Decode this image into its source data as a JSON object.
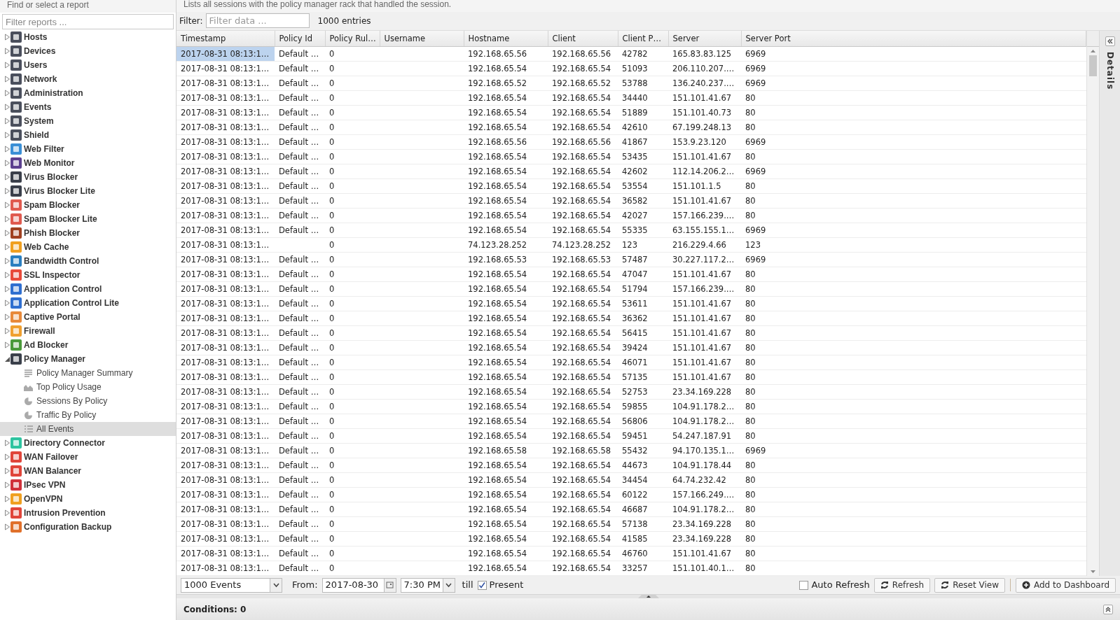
{
  "sidebar": {
    "heading": "Find or select a report",
    "filter": {
      "placeholder": "Filter reports ..."
    },
    "tree": [
      {
        "label": "Hosts",
        "color": "#4a4f5c",
        "expanded": false,
        "selected": false
      },
      {
        "label": "Devices",
        "color": "#4a4f5c",
        "expanded": false,
        "selected": false
      },
      {
        "label": "Users",
        "color": "#4a4f5c",
        "expanded": false,
        "selected": false
      },
      {
        "label": "Network",
        "color": "#4a4f5c",
        "expanded": false,
        "selected": false
      },
      {
        "label": "Administration",
        "color": "#4a4f5c",
        "expanded": false,
        "selected": false
      },
      {
        "label": "Events",
        "color": "#4a4f5c",
        "expanded": false,
        "selected": false
      },
      {
        "label": "System",
        "color": "#4a4f5c",
        "expanded": false,
        "selected": false
      },
      {
        "label": "Shield",
        "color": "#4a4f5c",
        "expanded": false,
        "selected": false
      },
      {
        "label": "Web Filter",
        "color": "#3a8fd6",
        "expanded": false,
        "selected": false
      },
      {
        "label": "Web Monitor",
        "color": "#5b3f8f",
        "expanded": false,
        "selected": false
      },
      {
        "label": "Virus Blocker",
        "color": "#3a3f4a",
        "expanded": false,
        "selected": false
      },
      {
        "label": "Virus Blocker Lite",
        "color": "#3a3f4a",
        "expanded": false,
        "selected": false
      },
      {
        "label": "Spam Blocker",
        "color": "#e05a4f",
        "expanded": false,
        "selected": false
      },
      {
        "label": "Spam Blocker Lite",
        "color": "#e05a4f",
        "expanded": false,
        "selected": false
      },
      {
        "label": "Phish Blocker",
        "color": "#a04020",
        "expanded": false,
        "selected": false
      },
      {
        "label": "Web Cache",
        "color": "#f0a020",
        "expanded": false,
        "selected": false
      },
      {
        "label": "Bandwidth Control",
        "color": "#2a7fc0",
        "expanded": false,
        "selected": false
      },
      {
        "label": "SSL Inspector",
        "color": "#e84a3a",
        "expanded": false,
        "selected": false
      },
      {
        "label": "Application Control",
        "color": "#2f6fd0",
        "expanded": false,
        "selected": false
      },
      {
        "label": "Application Control Lite",
        "color": "#2f6fd0",
        "expanded": false,
        "selected": false
      },
      {
        "label": "Captive Portal",
        "color": "#e88a3a",
        "expanded": false,
        "selected": false
      },
      {
        "label": "Firewall",
        "color": "#f0a030",
        "expanded": false,
        "selected": false
      },
      {
        "label": "Ad Blocker",
        "color": "#4a9a3a",
        "expanded": false,
        "selected": false
      },
      {
        "label": "Policy Manager",
        "color": "#3a3f4a",
        "expanded": true,
        "selected": false,
        "children": [
          {
            "label": "Policy Manager Summary",
            "kind": "text",
            "selected": false
          },
          {
            "label": "Top Policy Usage",
            "kind": "area",
            "selected": false
          },
          {
            "label": "Sessions By Policy",
            "kind": "pie",
            "selected": false
          },
          {
            "label": "Traffic By Policy",
            "kind": "pie",
            "selected": false
          },
          {
            "label": "All Events",
            "kind": "list",
            "selected": true
          }
        ]
      },
      {
        "label": "Directory Connector",
        "color": "#2ec4a0",
        "expanded": false,
        "selected": false
      },
      {
        "label": "WAN Failover",
        "color": "#e0453a",
        "expanded": false,
        "selected": false
      },
      {
        "label": "WAN Balancer",
        "color": "#e0453a",
        "expanded": false,
        "selected": false
      },
      {
        "label": "IPsec VPN",
        "color": "#d0303a",
        "expanded": false,
        "selected": false
      },
      {
        "label": "OpenVPN",
        "color": "#f0a020",
        "expanded": false,
        "selected": false
      },
      {
        "label": "Intrusion Prevention",
        "color": "#e0453a",
        "expanded": false,
        "selected": false
      },
      {
        "label": "Configuration Backup",
        "color": "#e0702a",
        "expanded": false,
        "selected": false
      }
    ]
  },
  "description": "Lists all sessions with the policy manager rack that handled the session.",
  "filter_bar": {
    "label": "Filter:",
    "placeholder": "Filter data ...",
    "count": "1000 entries"
  },
  "table": {
    "columns": [
      "Timestamp",
      "Policy Id",
      "Policy Rul…",
      "Username",
      "Hostname",
      "Client",
      "Client P…",
      "Server",
      "Server Port"
    ],
    "rows": [
      {
        "selected": true,
        "cells": [
          "2017-08-31 08:13:1…",
          "Default …",
          "0",
          "",
          "192.168.65.56",
          "192.168.65.56",
          "42782",
          "165.83.83.125",
          "6969"
        ]
      },
      {
        "selected": false,
        "cells": [
          "2017-08-31 08:13:1…",
          "Default …",
          "0",
          "",
          "192.168.65.54",
          "192.168.65.54",
          "51093",
          "206.110.207.…",
          "6969"
        ]
      },
      {
        "selected": false,
        "cells": [
          "2017-08-31 08:13:1…",
          "Default …",
          "0",
          "",
          "192.168.65.52",
          "192.168.65.52",
          "53788",
          "136.240.237.…",
          "6969"
        ]
      },
      {
        "selected": false,
        "cells": [
          "2017-08-31 08:13:1…",
          "Default …",
          "0",
          "",
          "192.168.65.54",
          "192.168.65.54",
          "34440",
          "151.101.41.67",
          "80"
        ]
      },
      {
        "selected": false,
        "cells": [
          "2017-08-31 08:13:1…",
          "Default …",
          "0",
          "",
          "192.168.65.54",
          "192.168.65.54",
          "51889",
          "151.101.40.73",
          "80"
        ]
      },
      {
        "selected": false,
        "cells": [
          "2017-08-31 08:13:1…",
          "Default …",
          "0",
          "",
          "192.168.65.54",
          "192.168.65.54",
          "42610",
          "67.199.248.13",
          "80"
        ]
      },
      {
        "selected": false,
        "cells": [
          "2017-08-31 08:13:1…",
          "Default …",
          "0",
          "",
          "192.168.65.56",
          "192.168.65.56",
          "41867",
          "153.9.23.120",
          "6969"
        ]
      },
      {
        "selected": false,
        "cells": [
          "2017-08-31 08:13:1…",
          "Default …",
          "0",
          "",
          "192.168.65.54",
          "192.168.65.54",
          "53435",
          "151.101.41.67",
          "80"
        ]
      },
      {
        "selected": false,
        "cells": [
          "2017-08-31 08:13:1…",
          "Default …",
          "0",
          "",
          "192.168.65.54",
          "192.168.65.54",
          "42602",
          "112.14.206.2…",
          "6969"
        ]
      },
      {
        "selected": false,
        "cells": [
          "2017-08-31 08:13:1…",
          "Default …",
          "0",
          "",
          "192.168.65.54",
          "192.168.65.54",
          "53554",
          "151.101.1.5",
          "80"
        ]
      },
      {
        "selected": false,
        "cells": [
          "2017-08-31 08:13:1…",
          "Default …",
          "0",
          "",
          "192.168.65.54",
          "192.168.65.54",
          "36582",
          "151.101.41.67",
          "80"
        ]
      },
      {
        "selected": false,
        "cells": [
          "2017-08-31 08:13:1…",
          "Default …",
          "0",
          "",
          "192.168.65.54",
          "192.168.65.54",
          "42027",
          "157.166.239.…",
          "80"
        ]
      },
      {
        "selected": false,
        "cells": [
          "2017-08-31 08:13:1…",
          "Default …",
          "0",
          "",
          "192.168.65.54",
          "192.168.65.54",
          "55335",
          "63.155.155.1…",
          "6969"
        ]
      },
      {
        "selected": false,
        "cells": [
          "2017-08-31 08:13:1…",
          "",
          "0",
          "",
          "74.123.28.252",
          "74.123.28.252",
          "123",
          "216.229.4.66",
          "123"
        ]
      },
      {
        "selected": false,
        "cells": [
          "2017-08-31 08:13:1…",
          "Default …",
          "0",
          "",
          "192.168.65.53",
          "192.168.65.53",
          "57487",
          "30.227.117.2…",
          "6969"
        ]
      },
      {
        "selected": false,
        "cells": [
          "2017-08-31 08:13:1…",
          "Default …",
          "0",
          "",
          "192.168.65.54",
          "192.168.65.54",
          "47047",
          "151.101.41.67",
          "80"
        ]
      },
      {
        "selected": false,
        "cells": [
          "2017-08-31 08:13:1…",
          "Default …",
          "0",
          "",
          "192.168.65.54",
          "192.168.65.54",
          "51794",
          "157.166.239.…",
          "80"
        ]
      },
      {
        "selected": false,
        "cells": [
          "2017-08-31 08:13:1…",
          "Default …",
          "0",
          "",
          "192.168.65.54",
          "192.168.65.54",
          "53611",
          "151.101.41.67",
          "80"
        ]
      },
      {
        "selected": false,
        "cells": [
          "2017-08-31 08:13:1…",
          "Default …",
          "0",
          "",
          "192.168.65.54",
          "192.168.65.54",
          "36362",
          "151.101.41.67",
          "80"
        ]
      },
      {
        "selected": false,
        "cells": [
          "2017-08-31 08:13:1…",
          "Default …",
          "0",
          "",
          "192.168.65.54",
          "192.168.65.54",
          "56415",
          "151.101.41.67",
          "80"
        ]
      },
      {
        "selected": false,
        "cells": [
          "2017-08-31 08:13:1…",
          "Default …",
          "0",
          "",
          "192.168.65.54",
          "192.168.65.54",
          "39424",
          "151.101.41.67",
          "80"
        ]
      },
      {
        "selected": false,
        "cells": [
          "2017-08-31 08:13:1…",
          "Default …",
          "0",
          "",
          "192.168.65.54",
          "192.168.65.54",
          "46071",
          "151.101.41.67",
          "80"
        ]
      },
      {
        "selected": false,
        "cells": [
          "2017-08-31 08:13:1…",
          "Default …",
          "0",
          "",
          "192.168.65.54",
          "192.168.65.54",
          "57135",
          "151.101.41.67",
          "80"
        ]
      },
      {
        "selected": false,
        "cells": [
          "2017-08-31 08:13:1…",
          "Default …",
          "0",
          "",
          "192.168.65.54",
          "192.168.65.54",
          "52753",
          "23.34.169.228",
          "80"
        ]
      },
      {
        "selected": false,
        "cells": [
          "2017-08-31 08:13:1…",
          "Default …",
          "0",
          "",
          "192.168.65.54",
          "192.168.65.54",
          "59855",
          "104.91.178.2…",
          "80"
        ]
      },
      {
        "selected": false,
        "cells": [
          "2017-08-31 08:13:1…",
          "Default …",
          "0",
          "",
          "192.168.65.54",
          "192.168.65.54",
          "56806",
          "104.91.178.2…",
          "80"
        ]
      },
      {
        "selected": false,
        "cells": [
          "2017-08-31 08:13:1…",
          "Default …",
          "0",
          "",
          "192.168.65.54",
          "192.168.65.54",
          "59451",
          "54.247.187.91",
          "80"
        ]
      },
      {
        "selected": false,
        "cells": [
          "2017-08-31 08:13:1…",
          "Default …",
          "0",
          "",
          "192.168.65.58",
          "192.168.65.58",
          "55432",
          "94.170.135.1…",
          "6969"
        ]
      },
      {
        "selected": false,
        "cells": [
          "2017-08-31 08:13:1…",
          "Default …",
          "0",
          "",
          "192.168.65.54",
          "192.168.65.54",
          "44673",
          "104.91.178.44",
          "80"
        ]
      },
      {
        "selected": false,
        "cells": [
          "2017-08-31 08:13:1…",
          "Default …",
          "0",
          "",
          "192.168.65.54",
          "192.168.65.54",
          "34454",
          "64.74.232.42",
          "80"
        ]
      },
      {
        "selected": false,
        "cells": [
          "2017-08-31 08:13:1…",
          "Default …",
          "0",
          "",
          "192.168.65.54",
          "192.168.65.54",
          "60122",
          "157.166.249.…",
          "80"
        ]
      },
      {
        "selected": false,
        "cells": [
          "2017-08-31 08:13:1…",
          "Default …",
          "0",
          "",
          "192.168.65.54",
          "192.168.65.54",
          "46687",
          "104.91.178.2…",
          "80"
        ]
      },
      {
        "selected": false,
        "cells": [
          "2017-08-31 08:13:1…",
          "Default …",
          "0",
          "",
          "192.168.65.54",
          "192.168.65.54",
          "57138",
          "23.34.169.228",
          "80"
        ]
      },
      {
        "selected": false,
        "cells": [
          "2017-08-31 08:13:1…",
          "Default …",
          "0",
          "",
          "192.168.65.54",
          "192.168.65.54",
          "41585",
          "23.34.169.228",
          "80"
        ]
      },
      {
        "selected": false,
        "cells": [
          "2017-08-31 08:13:1…",
          "Default …",
          "0",
          "",
          "192.168.65.54",
          "192.168.65.54",
          "46760",
          "151.101.41.67",
          "80"
        ]
      },
      {
        "selected": false,
        "cells": [
          "2017-08-31 08:13:1…",
          "Default …",
          "0",
          "",
          "192.168.65.54",
          "192.168.65.54",
          "33257",
          "151.101.40.1…",
          "80"
        ]
      }
    ]
  },
  "details_panel": {
    "title": "Details"
  },
  "toolbar": {
    "limit": "1000 Events",
    "from_label": "From:",
    "date": "2017-08-30",
    "time": "7:30 PM",
    "till_label": "till",
    "present": {
      "label": "Present",
      "checked": true
    },
    "auto_refresh": {
      "label": "Auto Refresh",
      "checked": false
    },
    "buttons": [
      {
        "label": "Refresh",
        "kind": "refresh"
      },
      {
        "label": "Reset View",
        "kind": "refresh"
      },
      {
        "label": "Add to Dashboard",
        "kind": "add"
      }
    ]
  },
  "conditions": {
    "label": "Conditions: 0"
  }
}
